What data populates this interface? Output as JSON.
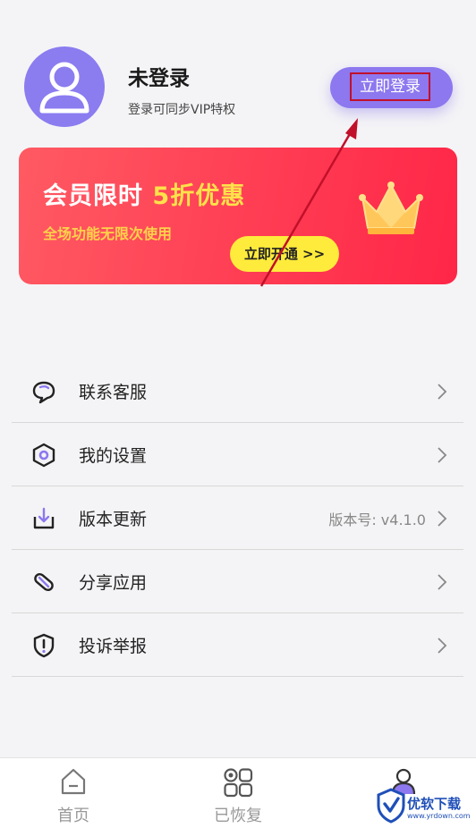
{
  "profile": {
    "name": "未登录",
    "subtitle": "登录可同步VIP特权",
    "login_label": "立即登录"
  },
  "banner": {
    "title_prefix": "会员限时",
    "title_highlight": "5折优惠",
    "subtitle": "全场功能无限次使用",
    "cta_label": "立即开通 >>"
  },
  "menu": {
    "items": [
      {
        "label": "联系客服",
        "icon": "chat-bubble-icon"
      },
      {
        "label": "我的设置",
        "icon": "hexagon-settings-icon"
      },
      {
        "label": "版本更新",
        "icon": "download-icon",
        "value": "版本号: v4.1.0"
      },
      {
        "label": "分享应用",
        "icon": "link-icon"
      },
      {
        "label": "投诉举报",
        "icon": "shield-alert-icon"
      }
    ]
  },
  "tabs": {
    "items": [
      {
        "label": "首页",
        "icon": "home-icon"
      },
      {
        "label": "已恢复",
        "icon": "grid-icon"
      },
      {
        "label": "",
        "icon": "profile-icon"
      }
    ]
  },
  "watermark": {
    "text": "优软下载",
    "url": "www.yrdown.com"
  },
  "colors": {
    "accent": "#8d78ef",
    "banner": "#ff3a52",
    "highlight": "#ffe14a",
    "cta": "#ffeb3b",
    "annotation": "#c1102a"
  }
}
